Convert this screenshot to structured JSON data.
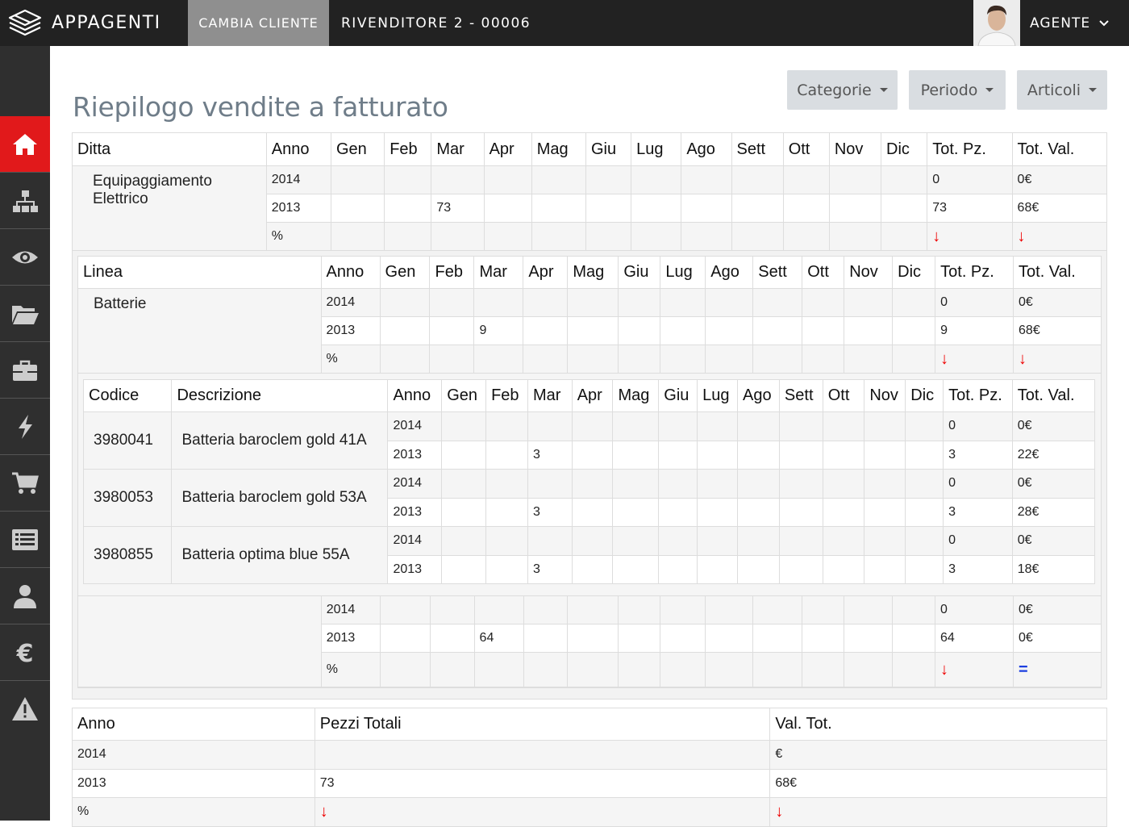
{
  "header": {
    "brand": "APPAGENTI",
    "change_client": "CAMBIA CLIENTE",
    "reseller": "RIVENDITORE 2 - 00006",
    "agent": "AGENTE"
  },
  "sidebar": {
    "items": [
      {
        "icon": "home-icon",
        "active": true
      },
      {
        "icon": "sitemap-icon"
      },
      {
        "icon": "eye-icon"
      },
      {
        "icon": "folder-open-icon"
      },
      {
        "icon": "briefcase-icon"
      },
      {
        "icon": "bolt-icon"
      },
      {
        "icon": "cart-icon"
      },
      {
        "icon": "list-icon"
      },
      {
        "icon": "user-icon"
      },
      {
        "icon": "euro-icon"
      },
      {
        "icon": "warning-icon"
      }
    ],
    "accent": "#e1191b"
  },
  "page": {
    "title": "Riepilogo vendite a fatturato",
    "filters": [
      "Categorie",
      "Periodo",
      "Articoli"
    ]
  },
  "months": [
    "Gen",
    "Feb",
    "Mar",
    "Apr",
    "Mag",
    "Giu",
    "Lug",
    "Ago",
    "Sett",
    "Ott",
    "Nov",
    "Dic"
  ],
  "labels": {
    "ditta": "Ditta",
    "linea": "Linea",
    "codice": "Codice",
    "descrizione": "Descrizione",
    "anno": "Anno",
    "tot_pz": "Tot. Pz.",
    "tot_val": "Tot. Val.",
    "pezzi_totali": "Pezzi Totali",
    "val_tot": "Val. Tot."
  },
  "ditta": {
    "name": "Equipaggiamento Elettrico",
    "rows": [
      {
        "anno": "2014",
        "mar": "",
        "pz": "0",
        "val": "0€"
      },
      {
        "anno": "2013",
        "mar": "73",
        "pz": "73",
        "val": "68€"
      },
      {
        "anno": "%",
        "mar": "",
        "pz": "down",
        "val": "down"
      }
    ]
  },
  "linea": {
    "name": "Batterie",
    "rows": [
      {
        "anno": "2014",
        "mar": "",
        "pz": "0",
        "val": "0€"
      },
      {
        "anno": "2013",
        "mar": "9",
        "pz": "9",
        "val": "68€"
      },
      {
        "anno": "%",
        "mar": "",
        "pz": "down",
        "val": "down"
      }
    ]
  },
  "articoli": [
    {
      "codice": "3980041",
      "descrizione": "Batteria baroclem gold 41A",
      "rows": [
        {
          "anno": "2014",
          "mar": "",
          "pz": "0",
          "val": "0€"
        },
        {
          "anno": "2013",
          "mar": "3",
          "pz": "3",
          "val": "22€"
        }
      ]
    },
    {
      "codice": "3980053",
      "descrizione": "Batteria baroclem gold 53A",
      "rows": [
        {
          "anno": "2014",
          "mar": "",
          "pz": "0",
          "val": "0€"
        },
        {
          "anno": "2013",
          "mar": "3",
          "pz": "3",
          "val": "28€"
        }
      ]
    },
    {
      "codice": "3980855",
      "descrizione": "Batteria optima blue 55A",
      "rows": [
        {
          "anno": "2014",
          "mar": "",
          "pz": "0",
          "val": "0€"
        },
        {
          "anno": "2013",
          "mar": "3",
          "pz": "3",
          "val": "18€"
        }
      ]
    }
  ],
  "linea_totale": {
    "rows": [
      {
        "anno": "2014",
        "mar": "",
        "pz": "0",
        "val": "0€"
      },
      {
        "anno": "2013",
        "mar": "64",
        "pz": "64",
        "val": "0€"
      },
      {
        "anno": "%",
        "mar": "",
        "pz": "down",
        "val": "equal"
      }
    ]
  },
  "riepilogo": {
    "rows": [
      {
        "anno": "2014",
        "pezzi": "",
        "val": "€"
      },
      {
        "anno": "2013",
        "pezzi": "73",
        "val": "68€"
      },
      {
        "anno": "%",
        "pezzi": "down",
        "val": "down"
      }
    ]
  }
}
